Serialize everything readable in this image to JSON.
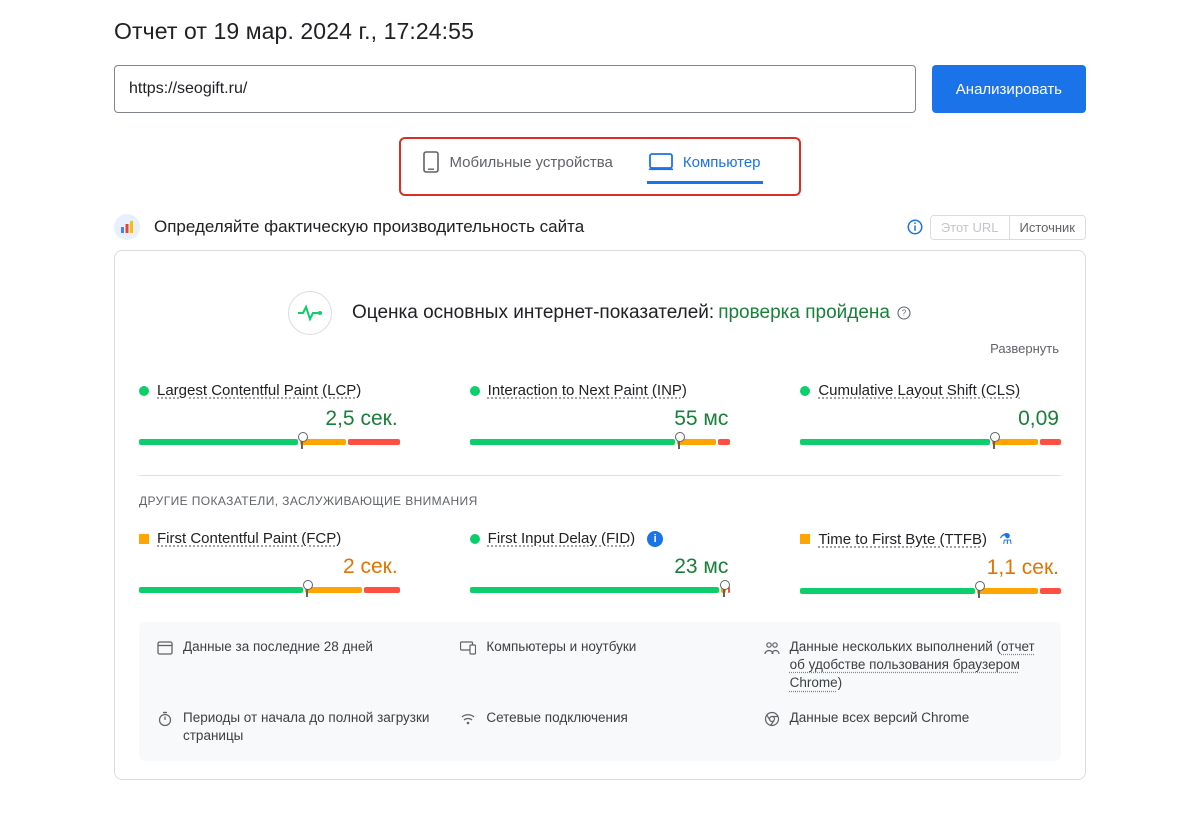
{
  "report_title": "Отчет от 19 мар. 2024 г., 17:24:55",
  "url_value": "https://seogift.ru/",
  "analyze_label": "Анализировать",
  "tabs": {
    "mobile": "Мобильные устройства",
    "desktop": "Компьютер"
  },
  "section": {
    "title": "Определяйте фактическую производительность сайта",
    "this_url": "Этот URL",
    "source": "Источник"
  },
  "cwv": {
    "label": "Оценка основных интернет-показателей:",
    "status": "проверка пройдена",
    "expand": "Развернуть"
  },
  "metrics_core": [
    {
      "name": "Largest Contentful Paint (LCP)",
      "value": "2,5 сек.",
      "status": "good",
      "segments": [
        62,
        18,
        20
      ],
      "pin": 62
    },
    {
      "name": "Interaction to Next Paint (INP)",
      "value": "55 мс",
      "status": "good",
      "segments": [
        80,
        15,
        5
      ],
      "pin": 80
    },
    {
      "name": "Cumulative Layout Shift (CLS)",
      "value": "0,09",
      "status": "good",
      "segments": [
        74,
        18,
        8
      ],
      "pin": 74
    }
  ],
  "sub_heading": "ДРУГИЕ ПОКАЗАТЕЛИ, ЗАСЛУЖИВАЮЩИЕ ВНИМАНИЯ",
  "metrics_other": [
    {
      "name": "First Contentful Paint (FCP)",
      "value": "2 сек.",
      "status": "ok",
      "segments": [
        64,
        22,
        14
      ],
      "pin": 64,
      "extra": ""
    },
    {
      "name": "First Input Delay (FID)",
      "value": "23 мс",
      "status": "good",
      "segments": [
        97,
        2,
        1
      ],
      "pin": 97,
      "extra": "info"
    },
    {
      "name": "Time to First Byte (TTFB)",
      "value": "1,1 сек.",
      "status": "ok",
      "segments": [
        68,
        24,
        8
      ],
      "pin": 68,
      "extra": "flask"
    }
  ],
  "legend": {
    "period": "Данные за последние 28 дней",
    "devices": "Компьютеры и ноутбуки",
    "many_visits_pre": "Данные нескольких выполнений (",
    "many_visits_link": "отчет об удобстве пользования браузером Chrome",
    "many_visits_post": ")",
    "full_load": "Периоды от начала до полной загрузки страницы",
    "network": "Сетевые подключения",
    "all_chrome": "Данные всех версий Chrome"
  }
}
